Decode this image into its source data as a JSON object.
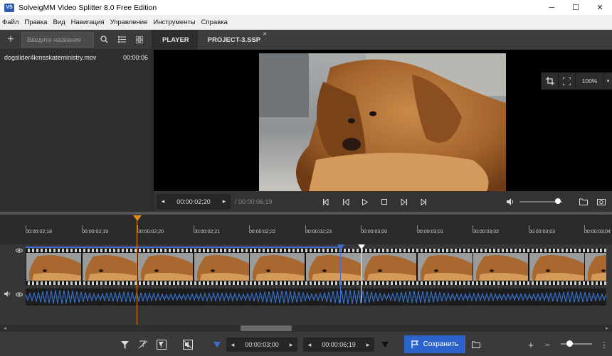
{
  "window": {
    "title": "SolveigMM Video Splitter 8.0 Free Edition",
    "icon_text": "VS",
    "minimize": "─",
    "maximize": "☐",
    "close": "✕"
  },
  "menu": [
    "Файл",
    "Правка",
    "Вид",
    "Навигация",
    "Управление",
    "Инструменты",
    "Справка"
  ],
  "left_panel": {
    "add": "+",
    "search_placeholder": "Введите название",
    "files": [
      {
        "name": "dogslider4kmsskateministry.mov",
        "duration": "00:00:06"
      }
    ]
  },
  "tabs": [
    {
      "label": "PLAYER",
      "active": false
    },
    {
      "label": "PROJECT-3.SSP",
      "active": true
    }
  ],
  "view_tools": {
    "zoom_percent": "100%"
  },
  "player": {
    "current_time": "00:00:02;20",
    "total_time": "/ 00:00:06;19"
  },
  "ruler_labels": [
    "00:00:02;18",
    "00:00:02;19",
    "00:00:02;20",
    "00:00:02;21",
    "00:00:02;22",
    "00:00:02;23",
    "00:00:03;00",
    "00:00:03;01",
    "00:00:03;02",
    "00:00:03;03",
    "00:00:03;04"
  ],
  "bottom": {
    "start_time": "00:00:03;00",
    "end_time": "00:00:06;19",
    "save_label": "Сохранить",
    "zoom_plus": "+",
    "zoom_minus": "−"
  },
  "colors": {
    "accent": "#2d64cc",
    "playhead": "#e08a1a",
    "selection": "#3e6fd1"
  }
}
